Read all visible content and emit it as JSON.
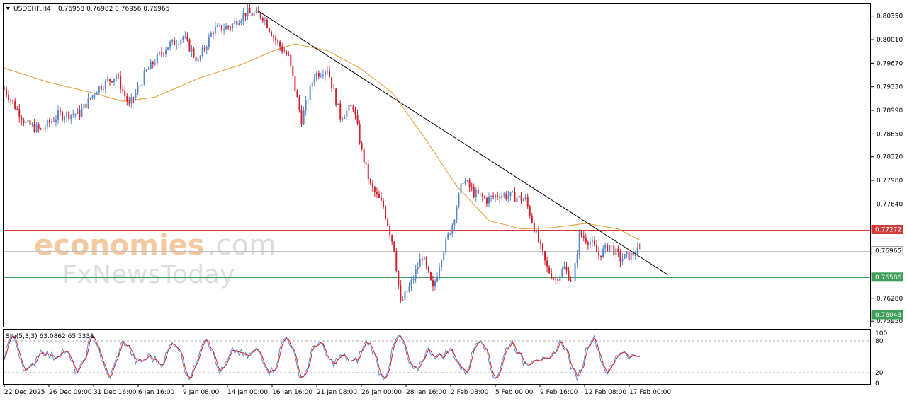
{
  "header": {
    "symbol": "USDCHF,H4",
    "ohlc": "0.76958 0.76982 0.76956 0.76965"
  },
  "watermark": {
    "line1_brand": "economies",
    "line1_domain": ".com",
    "line2": "FxNewsToday"
  },
  "price_axis": {
    "ticks": [
      "0.80350",
      "0.80010",
      "0.79670",
      "0.79330",
      "0.78990",
      "0.78650",
      "0.78320",
      "0.77980",
      "0.77640",
      "0.76280",
      "0.75950"
    ]
  },
  "levels": {
    "resistance": "0.77272",
    "current": "0.76965",
    "support1": "0.76586",
    "support2": "0.76043"
  },
  "time_axis": {
    "labels": [
      "22 Dec 2025",
      "26 Dec 09:00",
      "31 Dec 16:00",
      "6 Jan 16:00",
      "9 Jan 08:00",
      "14 Jan 00:00",
      "16 Jan 16:00",
      "21 Jan 08:00",
      "26 Jan 00:00",
      "28 Jan 16:00",
      "2 Feb 08:00",
      "5 Feb 00:00",
      "9 Feb 16:00",
      "12 Feb 08:00",
      "17 Feb 00:00"
    ]
  },
  "stochastic": {
    "label": "Sto(5,3,3) 63.0862 65.5331",
    "levels": [
      "80",
      "20",
      "0"
    ],
    "tick_top": "100"
  },
  "colors": {
    "bull": "#5b86c8",
    "bear": "#d2202d",
    "ma": "#e8a040",
    "trendline": "#000000",
    "resistance": "#d13b3b",
    "support": "#3f9e5a",
    "current": "#c0c0c0",
    "stoch_main": "#5b86c8",
    "stoch_signal": "#d2202d"
  },
  "chart_data": {
    "type": "candlestick",
    "title": "USDCHF,H4",
    "y_range": [
      0.7588,
      0.8052
    ],
    "ma_label": "",
    "anchors": [
      {
        "i": 0,
        "p": 0.793
      },
      {
        "i": 10,
        "p": 0.788
      },
      {
        "i": 17,
        "p": 0.787
      },
      {
        "i": 25,
        "p": 0.7892
      },
      {
        "i": 35,
        "p": 0.7895
      },
      {
        "i": 43,
        "p": 0.793
      },
      {
        "i": 52,
        "p": 0.795
      },
      {
        "i": 58,
        "p": 0.7905
      },
      {
        "i": 66,
        "p": 0.7955
      },
      {
        "i": 75,
        "p": 0.799
      },
      {
        "i": 83,
        "p": 0.8005
      },
      {
        "i": 90,
        "p": 0.797
      },
      {
        "i": 97,
        "p": 0.8015
      },
      {
        "i": 105,
        "p": 0.802
      },
      {
        "i": 112,
        "p": 0.804
      },
      {
        "i": 120,
        "p": 0.8035
      },
      {
        "i": 126,
        "p": 0.8
      },
      {
        "i": 132,
        "p": 0.7975
      },
      {
        "i": 138,
        "p": 0.7885
      },
      {
        "i": 144,
        "p": 0.795
      },
      {
        "i": 150,
        "p": 0.796
      },
      {
        "i": 156,
        "p": 0.789
      },
      {
        "i": 162,
        "p": 0.7905
      },
      {
        "i": 166,
        "p": 0.784
      },
      {
        "i": 170,
        "p": 0.779
      },
      {
        "i": 176,
        "p": 0.776
      },
      {
        "i": 181,
        "p": 0.77
      },
      {
        "i": 184,
        "p": 0.762
      },
      {
        "i": 189,
        "p": 0.765
      },
      {
        "i": 194,
        "p": 0.769
      },
      {
        "i": 199,
        "p": 0.764
      },
      {
        "i": 203,
        "p": 0.769
      },
      {
        "i": 208,
        "p": 0.7735
      },
      {
        "i": 213,
        "p": 0.78
      },
      {
        "i": 218,
        "p": 0.778
      },
      {
        "i": 224,
        "p": 0.777
      },
      {
        "i": 230,
        "p": 0.7778
      },
      {
        "i": 236,
        "p": 0.7775
      },
      {
        "i": 242,
        "p": 0.777
      },
      {
        "i": 247,
        "p": 0.772
      },
      {
        "i": 252,
        "p": 0.767
      },
      {
        "i": 256,
        "p": 0.7655
      },
      {
        "i": 260,
        "p": 0.7672
      },
      {
        "i": 264,
        "p": 0.765
      },
      {
        "i": 267,
        "p": 0.772
      },
      {
        "i": 272,
        "p": 0.771
      },
      {
        "i": 276,
        "p": 0.769
      },
      {
        "i": 281,
        "p": 0.7705
      },
      {
        "i": 286,
        "p": 0.7685
      },
      {
        "i": 291,
        "p": 0.769
      },
      {
        "i": 295,
        "p": 0.7697
      }
    ],
    "ma_anchors": [
      {
        "i": 0,
        "p": 0.796
      },
      {
        "i": 20,
        "p": 0.794
      },
      {
        "i": 40,
        "p": 0.7925
      },
      {
        "i": 55,
        "p": 0.7912
      },
      {
        "i": 70,
        "p": 0.7918
      },
      {
        "i": 90,
        "p": 0.7945
      },
      {
        "i": 110,
        "p": 0.7965
      },
      {
        "i": 125,
        "p": 0.7985
      },
      {
        "i": 135,
        "p": 0.7995
      },
      {
        "i": 150,
        "p": 0.7985
      },
      {
        "i": 165,
        "p": 0.796
      },
      {
        "i": 180,
        "p": 0.7925
      },
      {
        "i": 195,
        "p": 0.786
      },
      {
        "i": 210,
        "p": 0.779
      },
      {
        "i": 225,
        "p": 0.774
      },
      {
        "i": 240,
        "p": 0.7728
      },
      {
        "i": 255,
        "p": 0.773
      },
      {
        "i": 270,
        "p": 0.7736
      },
      {
        "i": 285,
        "p": 0.7728
      },
      {
        "i": 295,
        "p": 0.7712
      }
    ],
    "trendline": [
      {
        "i": 118,
        "p": 0.8042
      },
      {
        "i": 308,
        "p": 0.7662
      }
    ],
    "candle_count": 296
  }
}
